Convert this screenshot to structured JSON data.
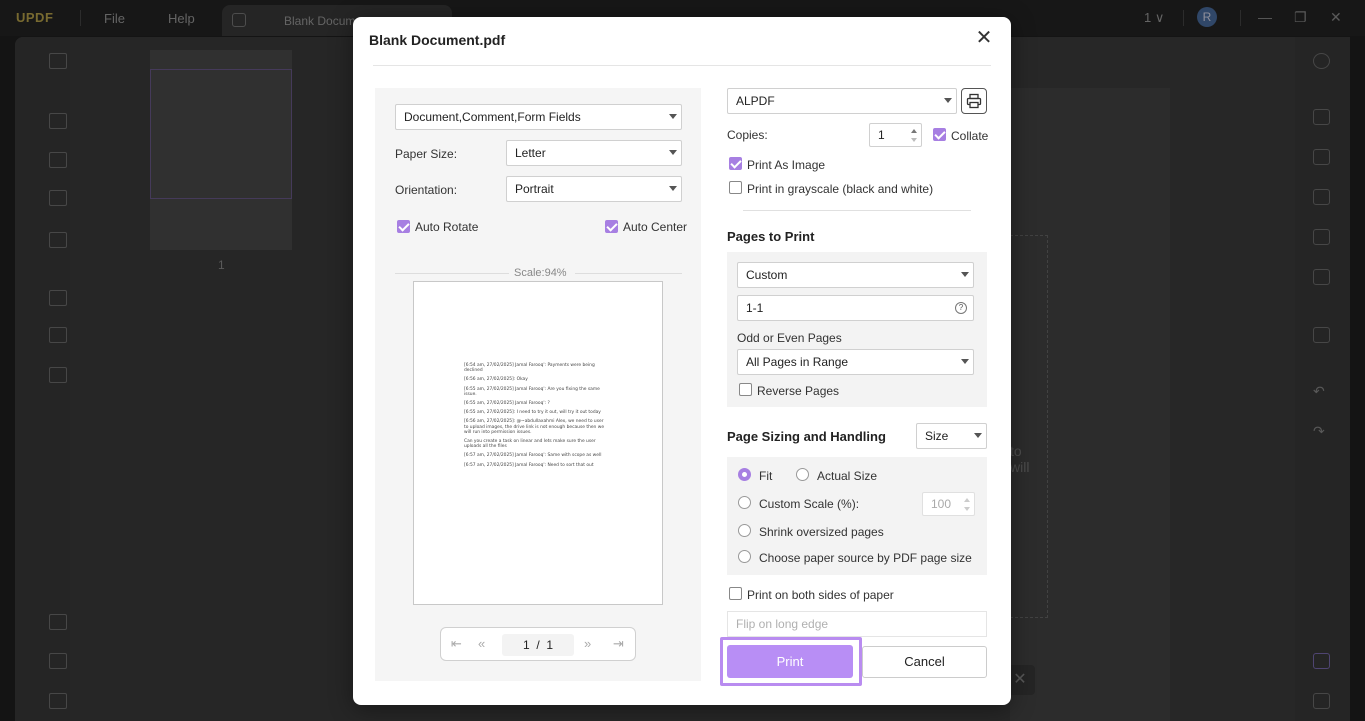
{
  "app": {
    "logo_main": "UPDF",
    "menu_file": "File",
    "menu_help": "Help",
    "tab_title": "Blank Docum",
    "page_indicator": "1 ∨",
    "avatar_initial": "R",
    "thumbnail_page_number": "1",
    "bg_fragment": "to\nwill"
  },
  "dialog": {
    "title": "Blank Document.pdf",
    "content_select": "Document,Comment,Form Fields",
    "paper_size_label": "Paper Size:",
    "paper_size_value": "Letter",
    "orientation_label": "Orientation:",
    "orientation_value": "Portrait",
    "auto_rotate_label": "Auto Rotate",
    "auto_center_label": "Auto Center",
    "scale_label": "Scale:94%",
    "preview_lines": [
      "[6:54 am, 27/02/2025] Jamal Farooq': Payments were being declined",
      "[6:56 am, 27/02/2025]: Okay",
      "[6:55 am, 27/02/2025] Jamal Farooq': Are you fixing the same issue.",
      "[6:55 am, 27/02/2025] Jamal Farooq': ?",
      "[6:55 am, 27/02/2025]: I need to try it out, will try it out today",
      "[6:56 am, 27/02/2025]: @~abdullaxahmi Alex, we need to user to upload images, the drive link is not enough because then we will run into permission issues.",
      "Can you create a task on linear and lets make sure the user uploads all the files",
      "[6:57 am, 27/02/2025] Jamal Farooq': Same with scope as well",
      "[6:57 am, 27/02/2025] Jamal Farooq': Need to sort that out"
    ],
    "pager_current": "1",
    "pager_sep": "/",
    "pager_total": "1",
    "printer_value": "ALPDF",
    "copies_label": "Copies:",
    "copies_value": "1",
    "collate_label": "Collate",
    "print_as_image_label": "Print As Image",
    "grayscale_label": "Print in grayscale (black and white)",
    "pages_to_print_title": "Pages to Print",
    "pages_mode_value": "Custom",
    "pages_range_value": "1-1",
    "odd_even_label": "Odd or Even Pages",
    "odd_even_value": "All Pages in Range",
    "reverse_pages_label": "Reverse Pages",
    "sizing_title": "Page Sizing and Handling",
    "sizing_mode_value": "Size",
    "fit_label": "Fit",
    "actual_size_label": "Actual Size",
    "custom_scale_label": "Custom Scale (%):",
    "custom_scale_value": "100",
    "shrink_label": "Shrink oversized pages",
    "paper_source_label": "Choose paper source by PDF page size",
    "both_sides_label": "Print on both sides of paper",
    "flip_value": "Flip on long edge",
    "print_button": "Print",
    "cancel_button": "Cancel"
  },
  "colors": {
    "accent": "#a77fe2",
    "print_button_bg": "#b88ef5"
  },
  "state": {
    "auto_rotate": true,
    "auto_center": true,
    "collate": true,
    "print_as_image": true,
    "grayscale": false,
    "reverse_pages": false,
    "sizing_option": "Fit",
    "both_sides": false
  }
}
